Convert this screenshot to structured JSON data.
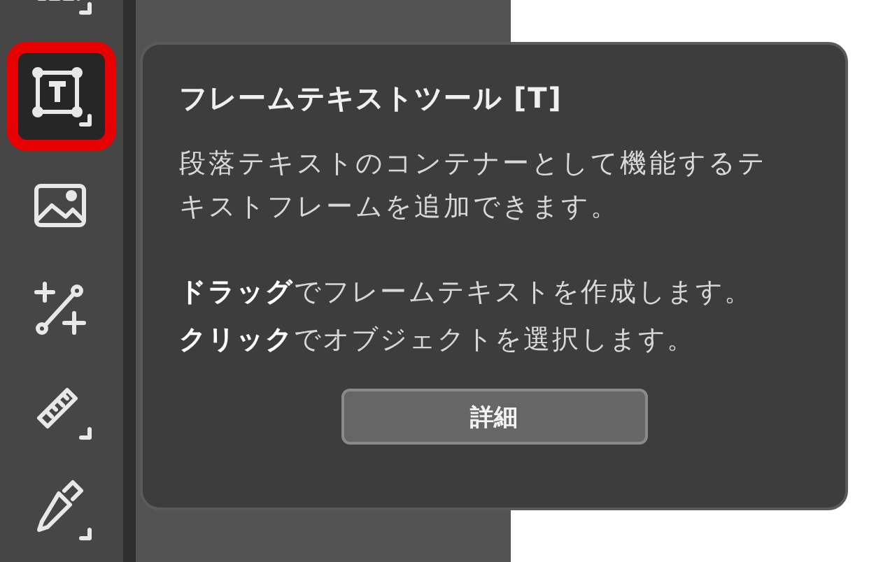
{
  "toolbar": {
    "tools": [
      {
        "kind": "frame",
        "selected": false,
        "submenu": true
      },
      {
        "kind": "text-frame",
        "selected": true,
        "submenu": true
      },
      {
        "kind": "image",
        "selected": false,
        "submenu": false
      },
      {
        "kind": "pen",
        "selected": false,
        "submenu": false
      },
      {
        "kind": "ruler",
        "selected": false,
        "submenu": true
      },
      {
        "kind": "eyedropper",
        "selected": false,
        "submenu": true
      }
    ]
  },
  "tooltip": {
    "title": "フレームテキストツール [T]",
    "description": "段落テキストのコンテナーとして機能するテキストフレームを追加できます。",
    "instructions": [
      "**ドラッグ**でフレームテキストを作成します。",
      "**クリック**でオブジェクトを選択します。"
    ],
    "button": "詳細"
  }
}
